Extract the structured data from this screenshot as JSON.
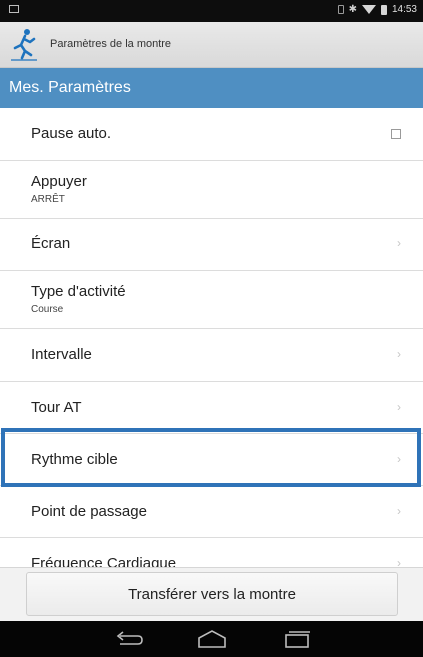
{
  "status_bar": {
    "time": "14:53",
    "bluetooth_glyph": "✱"
  },
  "app_bar": {
    "title": "Paramètres de la montre",
    "logo_icon": "runner-logo-icon"
  },
  "section": {
    "title": "Mes. Paramètres"
  },
  "settings": [
    {
      "title": "Pause auto.",
      "subtitle": "",
      "control": "checkbox",
      "checked": false
    },
    {
      "title": "Appuyer",
      "subtitle": "ARRÊT",
      "control": "none"
    },
    {
      "title": "Écran",
      "subtitle": "",
      "control": "chevron"
    },
    {
      "title": "Type d'activité",
      "subtitle": "Course",
      "control": "none"
    },
    {
      "title": "Intervalle",
      "subtitle": "",
      "control": "chevron"
    },
    {
      "title": "Tour AT",
      "subtitle": "",
      "control": "chevron"
    },
    {
      "title": "Rythme cible",
      "subtitle": "",
      "control": "chevron",
      "highlighted": true
    },
    {
      "title": "Point de passage",
      "subtitle": "",
      "control": "chevron"
    },
    {
      "title": "Fréquence Cardiaque",
      "subtitle": "",
      "control": "chevron"
    }
  ],
  "chevron_glyph": "›",
  "footer": {
    "transfer_label": "Transférer vers la montre"
  },
  "colors": {
    "section_header": "#4f8fc2",
    "highlight_border": "#2f73b8",
    "status_bar": "#0d0d0d",
    "nav_bar": "#050505"
  }
}
